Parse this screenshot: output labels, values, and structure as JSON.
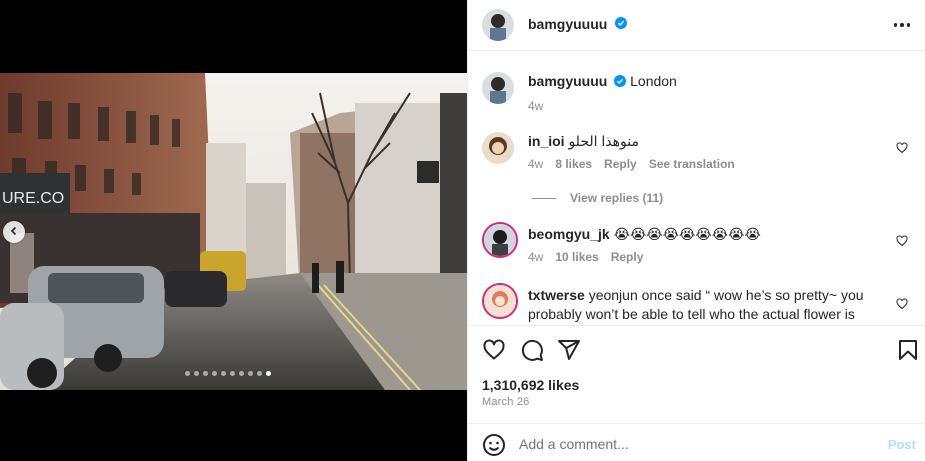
{
  "post": {
    "author": "bamgyuuuu",
    "verified": true,
    "location": "London",
    "age": "4w",
    "likes": "1,310,692 likes",
    "date": "March 26",
    "carousel": {
      "count": 10,
      "active_index": 9
    }
  },
  "comments": [
    {
      "user": "in_ioi",
      "text": "منوهذا الحلو",
      "age": "4w",
      "likes": "8 likes",
      "reply_label": "Reply",
      "translate_label": "See translation",
      "view_replies": "View replies (11)"
    },
    {
      "user": "beomgyu_jk",
      "text": "😭😭😭😭😭😭😭😭😭",
      "age": "4w",
      "likes": "10 likes",
      "reply_label": "Reply"
    },
    {
      "user": "txtwerse",
      "text": "yeonjun once said “ wow he’s so pretty~ you probably won’t be able to tell who the actual flower is at"
    }
  ],
  "composer": {
    "placeholder": "Add a comment...",
    "post_label": "Post"
  },
  "colors": {
    "verified": "#0095f6",
    "post_disabled": "#b2dffc",
    "meta": "#8e8e8e"
  },
  "icons": [
    "heart-icon",
    "comment-icon",
    "share-icon",
    "bookmark-icon",
    "emoji-icon",
    "more-icon",
    "verified-badge-icon",
    "chevron-left-icon"
  ]
}
